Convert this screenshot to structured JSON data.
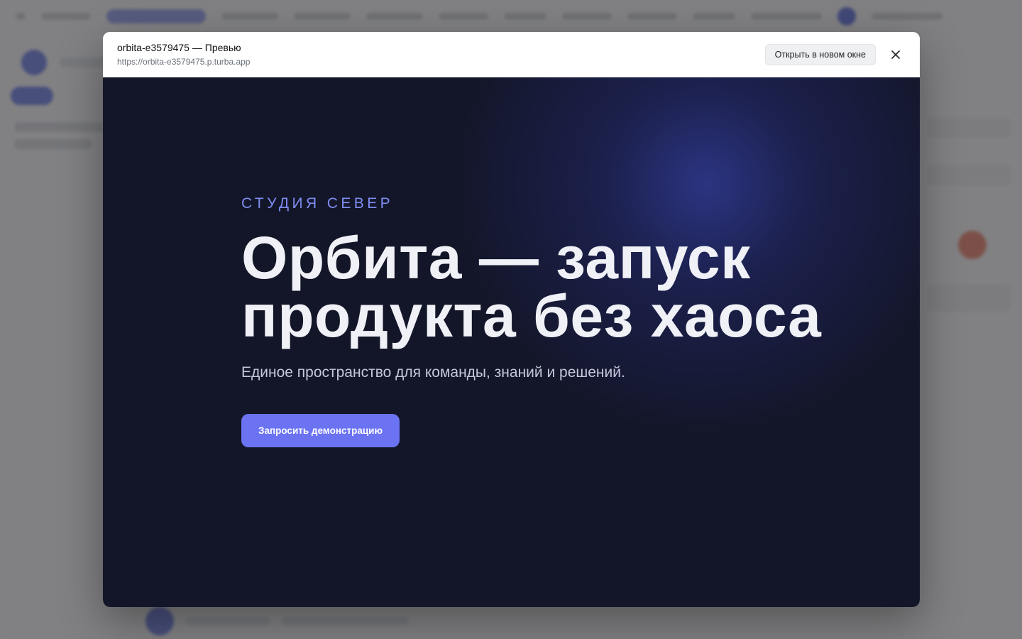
{
  "modal": {
    "title": "orbita-e3579475 — Превью",
    "url": "https://orbita-e3579475.p.turba.app",
    "open_new_window_label": "Открыть в новом окне",
    "close_icon": "close-icon"
  },
  "preview": {
    "eyebrow": "СТУДИЯ СЕВЕР",
    "headline": "Орбита — запуск продукта без хаоса",
    "subhead": "Единое пространство для команды, знаний и решений.",
    "cta_label": "Запросить демонстрацию"
  },
  "colors": {
    "preview_bg": "#131628",
    "accent": "#6b73f2",
    "eyebrow": "#7f8cf2",
    "scrim": "#464648"
  }
}
